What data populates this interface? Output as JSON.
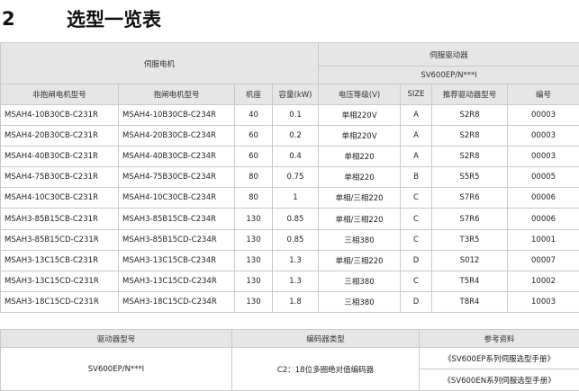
{
  "heading": {
    "number": "2",
    "title": "选型一览表"
  },
  "main_table": {
    "motor_group": "伺服电机",
    "drive_group": "伺服驱动器",
    "drive_series": "SV600EP/N***I",
    "columns": [
      "非抱闸电机型号",
      "抱闸电机型号",
      "机座",
      "容量(kW)",
      "电压等级(V)",
      "SIZE",
      "推荐驱动器型号",
      "编号"
    ],
    "rows": [
      [
        "MSAH4-10B30CB-C231R",
        "MSAH4-10B30CB-C234R",
        "40",
        "0.1",
        "单相220V",
        "A",
        "S2R8",
        "00003"
      ],
      [
        "MSAH4-20B30CB-C231R",
        "MSAH4-20B30CB-C234R",
        "60",
        "0.2",
        "单相220V",
        "A",
        "S2R8",
        "00003"
      ],
      [
        "MSAH4-40B30CB-C231R",
        "MSAH4-40B30CB-C234R",
        "60",
        "0.4",
        "单相220",
        "A",
        "S2R8",
        "00003"
      ],
      [
        "MSAH4-75B30CB-C231R",
        "MSAH4-75B30CB-C234R",
        "80",
        "0.75",
        "单相220",
        "B",
        "S5R5",
        "00005"
      ],
      [
        "MSAH4-10C30CB-C231R",
        "MSAH4-10C30CB-C234R",
        "80",
        "1",
        "单相/三相220",
        "C",
        "S7R6",
        "00006"
      ],
      [
        "MSAH3-85B15CB-C231R",
        "MSAH3-85B15CB-C234R",
        "130",
        "0.85",
        "单相/三相220",
        "C",
        "S7R6",
        "00006"
      ],
      [
        "MSAH3-85B15CD-C231R",
        "MSAH3-85B15CD-C234R",
        "130",
        "0.85",
        "三相380",
        "C",
        "T3R5",
        "10001"
      ],
      [
        "MSAH3-13C15CB-C231R",
        "MSAH3-13C15CB-C234R",
        "130",
        "1.3",
        "单相/三相220",
        "D",
        "S012",
        "00007"
      ],
      [
        "MSAH3-13C15CD-C231R",
        "MSAH3-13C15CD-C234R",
        "130",
        "1.3",
        "三相380",
        "C",
        "T5R4",
        "10002"
      ],
      [
        "MSAH3-18C15CD-C231R",
        "MSAH3-18C15CD-C234R",
        "130",
        "1.8",
        "三相380",
        "D",
        "T8R4",
        "10003"
      ]
    ]
  },
  "info_table": {
    "columns": [
      "驱动器型号",
      "编码器类型",
      "参考资料"
    ],
    "drive_model": "SV600EP/N***I",
    "encoder_type": "C2：18位多圈绝对值编码器",
    "references": [
      "《SV600EP系列伺服选型手册》",
      "《SV600EN系列伺服选型手册》"
    ]
  }
}
